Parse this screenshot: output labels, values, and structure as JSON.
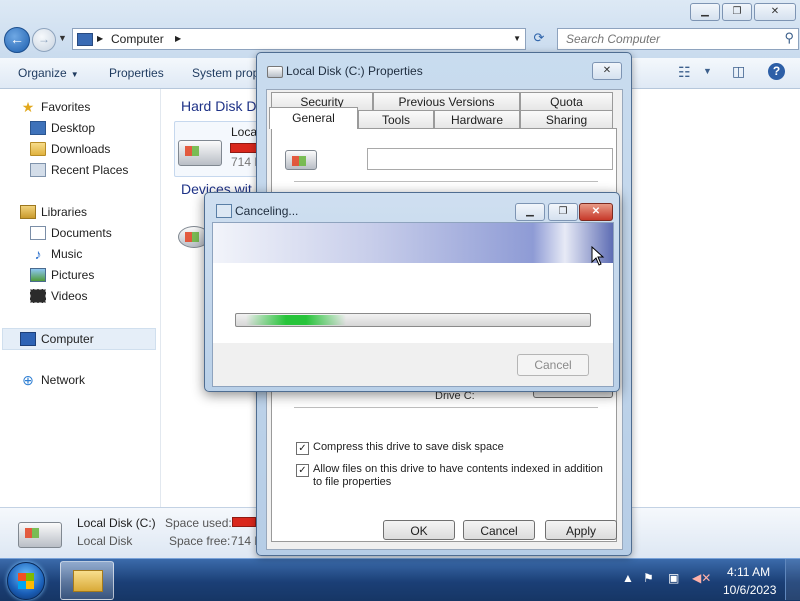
{
  "explorer": {
    "address": {
      "crumb": "Computer"
    },
    "search": {
      "placeholder": "Search Computer"
    },
    "command_bar": {
      "organize": "Organize",
      "properties": "Properties",
      "system_properties": "System prop"
    },
    "nav": {
      "favorites": "Favorites",
      "desktop": "Desktop",
      "downloads": "Downloads",
      "recent_places": "Recent Places",
      "libraries": "Libraries",
      "documents": "Documents",
      "music": "Music",
      "pictures": "Pictures",
      "videos": "Videos",
      "computer": "Computer",
      "network": "Network"
    },
    "content": {
      "group_hard_disk": "Hard Disk D",
      "group_devices": "Devices wit",
      "drive_name": "Local",
      "drive_size": "714 M"
    },
    "details": {
      "name": "Local Disk (C:)",
      "type": "Local Disk",
      "space_used_label": "Space used:",
      "space_free_label": "Space free:",
      "space_free_value": "714 M"
    }
  },
  "properties_dialog": {
    "title": "Local Disk (C:) Properties",
    "tabs_row1": [
      "Security",
      "Previous Versions",
      "Quota"
    ],
    "tabs_row2": [
      "General",
      "Tools",
      "Hardware",
      "Sharing"
    ],
    "drive_label": "Drive C:",
    "compress_label": "Compress this drive to save disk space",
    "index_label": "Allow files on this drive to have contents indexed in addition to file properties",
    "ok": "OK",
    "cancel": "Cancel",
    "apply": "Apply"
  },
  "cancel_dialog": {
    "title": "Canceling...",
    "cancel_button": "Cancel"
  },
  "taskbar": {
    "time": "4:11 AM",
    "date": "10/6/2023"
  }
}
